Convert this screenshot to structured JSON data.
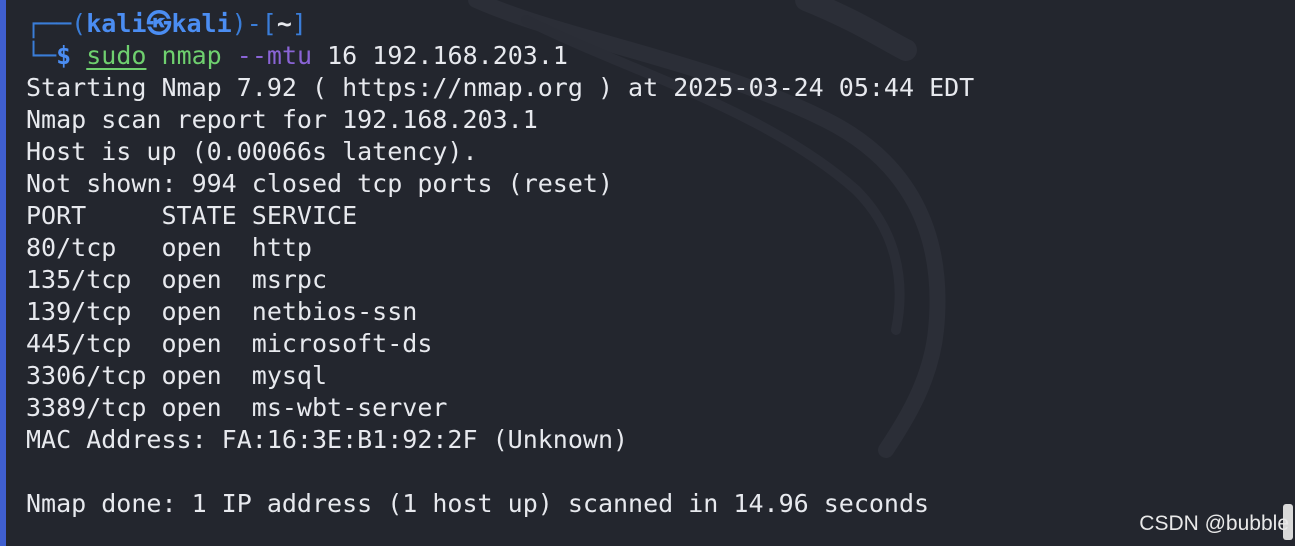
{
  "prompt": {
    "frame_open": "┌──(",
    "user": "kali",
    "skull": "㉿",
    "host": "kali",
    "frame_mid": ")-[",
    "dir": "~",
    "frame_close": "]",
    "frame_corner": "└─",
    "dollar": "$"
  },
  "command": {
    "sudo": "sudo",
    "program": "nmap",
    "option": "--mtu",
    "args": "16 192.168.203.1"
  },
  "output": [
    "Starting Nmap 7.92 ( https://nmap.org ) at 2025-03-24 05:44 EDT",
    "Nmap scan report for 192.168.203.1",
    "Host is up (0.00066s latency).",
    "Not shown: 994 closed tcp ports (reset)",
    "PORT     STATE SERVICE",
    "80/tcp   open  http",
    "135/tcp  open  msrpc",
    "139/tcp  open  netbios-ssn",
    "445/tcp  open  microsoft-ds",
    "3306/tcp open  mysql",
    "3389/tcp open  ms-wbt-server",
    "MAC Address: FA:16:3E:B1:92:2F (Unknown)",
    "",
    "Nmap done: 1 IP address (1 host up) scanned in 14.96 seconds"
  ],
  "watermark": "CSDN @bubble",
  "colors": {
    "background": "#23262e",
    "prompt_blue": "#4b8df2",
    "command_green": "#6fd06f",
    "option_purple": "#8a64d6",
    "text": "#e7e9ee"
  }
}
